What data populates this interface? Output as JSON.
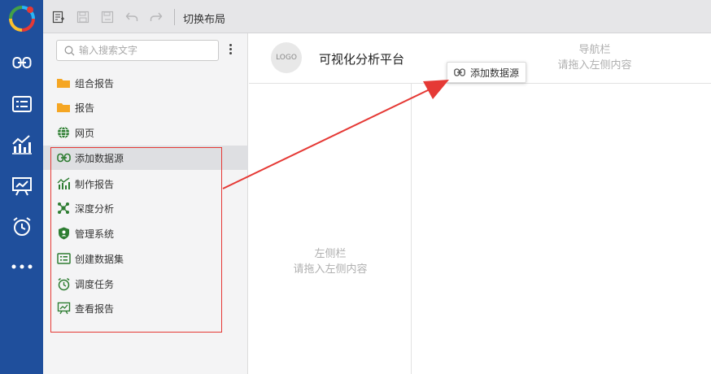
{
  "toolbar": {
    "switch_layout_label": "切换布局"
  },
  "rail": {
    "items": [
      "link-icon",
      "list-icon",
      "bar-chart-icon",
      "presentation-icon",
      "alarm-icon",
      "more-icon"
    ]
  },
  "panel": {
    "search_placeholder": "输入搜索文字",
    "items": [
      {
        "label": "组合报告",
        "icon": "folder-icon"
      },
      {
        "label": "报告",
        "icon": "folder-icon"
      },
      {
        "label": "网页",
        "icon": "globe-icon"
      },
      {
        "label": "添加数据源",
        "icon": "link-icon"
      },
      {
        "label": "制作报告",
        "icon": "bar-chart-icon"
      },
      {
        "label": "深度分析",
        "icon": "network-icon"
      },
      {
        "label": "管理系统",
        "icon": "shield-icon"
      },
      {
        "label": "创建数据集",
        "icon": "dataset-icon"
      },
      {
        "label": "调度任务",
        "icon": "alarm-icon"
      },
      {
        "label": "查看报告",
        "icon": "presentation-icon"
      }
    ],
    "selected_item": "添加数据源"
  },
  "canvas": {
    "logo_text": "LOGO",
    "platform_title": "可视化分析平台",
    "nav_hint_title": "导航栏",
    "nav_hint_sub": "请拖入左侧内容",
    "left_hint_title": "左侧栏",
    "left_hint_sub": "请拖入左侧内容",
    "drag_tip_label": "添加数据源"
  },
  "colors": {
    "rail": "#1f4f9c",
    "accent_green": "#2e7d32",
    "folder": "#f5a623",
    "annotation_red": "#e53935"
  }
}
